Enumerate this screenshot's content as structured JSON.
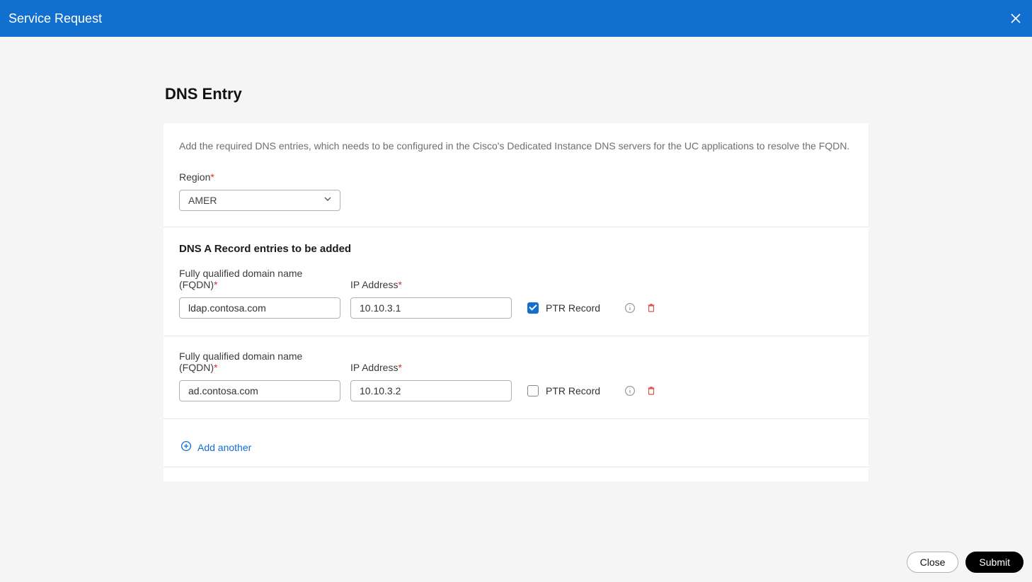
{
  "header": {
    "title": "Service Request"
  },
  "page": {
    "title": "DNS Entry",
    "description": "Add the required DNS entries, which needs to be configured in the Cisco's Dedicated Instance DNS servers for the UC applications to resolve the FQDN."
  },
  "region": {
    "label": "Region",
    "value": "AMER"
  },
  "records_section": {
    "title": "DNS A Record entries to be added",
    "fqdn_label": "Fully qualified domain name (FQDN)",
    "ip_label": "IP Address",
    "ptr_label": "PTR Record",
    "rows": [
      {
        "fqdn": "ldap.contosa.com",
        "ip": "10.10.3.1",
        "ptr": true
      },
      {
        "fqdn": "ad.contosa.com",
        "ip": "10.10.3.2",
        "ptr": false
      }
    ]
  },
  "actions": {
    "add_another": "Add another",
    "close": "Close",
    "submit": "Submit"
  }
}
